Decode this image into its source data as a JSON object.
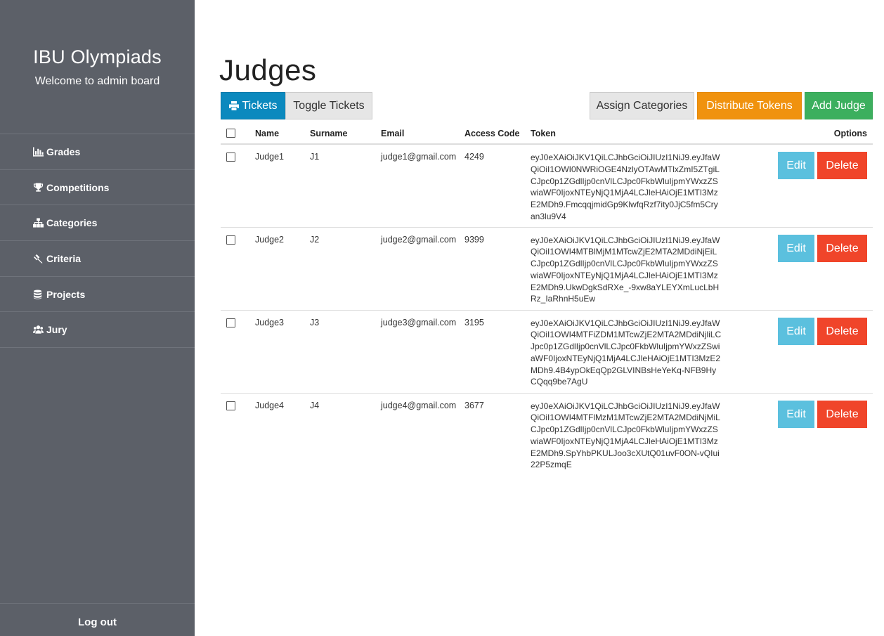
{
  "sidebar": {
    "title": "IBU Olympiads",
    "subtitle": "Welcome to admin board",
    "items": [
      {
        "label": "Grades",
        "icon": "bar-chart-icon"
      },
      {
        "label": "Competitions",
        "icon": "trophy-icon"
      },
      {
        "label": "Categories",
        "icon": "sitemap-icon"
      },
      {
        "label": "Criteria",
        "icon": "gavel-icon"
      },
      {
        "label": "Projects",
        "icon": "database-icon"
      },
      {
        "label": "Jury",
        "icon": "users-icon"
      }
    ],
    "logout": "Log out"
  },
  "main": {
    "title": "Judges",
    "buttons": {
      "tickets": "Tickets",
      "toggle": "Toggle Tickets",
      "assign": "Assign Categories",
      "distribute": "Distribute Tokens",
      "add": "Add Judge"
    }
  },
  "table": {
    "headers": {
      "name": "Name",
      "surname": "Surname",
      "email": "Email",
      "code": "Access Code",
      "token": "Token",
      "options": "Options"
    },
    "rows": [
      {
        "name": "Judge1",
        "surname": "J1",
        "email": "judge1@gmail.com",
        "code": "4249",
        "token": "eyJ0eXAiOiJKV1QiLCJhbGciOiJIUzI1NiJ9.eyJfaWQiOiI1OWI0NWRiOGE4NzlyOTAwMTlxZmI5ZTgiLCJpc0p1ZGdlIjp0cnVlLCJpc0FkbWluIjpmYWxzZSwiaWF0IjoxNTEyNjQ1MjA4LCJleHAiOjE1MTI3MzE2MDh9.FmcqqjmidGp9KlwfqRzf7ity0JjC5fm5Cryan3lu9V4"
      },
      {
        "name": "Judge2",
        "surname": "J2",
        "email": "judge2@gmail.com",
        "code": "9399",
        "token": "eyJ0eXAiOiJKV1QiLCJhbGciOiJIUzI1NiJ9.eyJfaWQiOiI1OWI4MTBlMjM1MTcwZjE2MTA2MDdiNjEiLCJpc0p1ZGdlIjp0cnVlLCJpc0FkbWluIjpmYWxzZSwiaWF0IjoxNTEyNjQ1MjA4LCJleHAiOjE1MTI3MzE2MDh9.UkwDgkSdRXe_-9xw8aYLEYXmLucLbHRz_IaRhnH5uEw"
      },
      {
        "name": "Judge3",
        "surname": "J3",
        "email": "judge3@gmail.com",
        "code": "3195",
        "token": "eyJ0eXAiOiJKV1QiLCJhbGciOiJIUzI1NiJ9.eyJfaWQiOiI1OWI4MTFiZDM1MTcwZjE2MTA2MDdiNjliLCJpc0p1ZGdlIjp0cnVlLCJpc0FkbWluIjpmYWxzZSwiaWF0IjoxNTEyNjQ1MjA4LCJleHAiOjE1MTI3MzE2MDh9.4B4ypOkEqQp2GLVINBsHeYeKq-NFB9HyCQqq9be7AgU"
      },
      {
        "name": "Judge4",
        "surname": "J4",
        "email": "judge4@gmail.com",
        "code": "3677",
        "token": "eyJ0eXAiOiJKV1QiLCJhbGciOiJIUzI1NiJ9.eyJfaWQiOiI1OWI4MTFlMzM1MTcwZjE2MTA2MDdiNjMiLCJpc0p1ZGdlIjp0cnVlLCJpc0FkbWluIjpmYWxzZSwiaWF0IjoxNTEyNjQ1MjA4LCJleHAiOjE1MTI3MzE2MDh9.SpYhbPKULJoo3cXUtQ01uvF0ON-vQIui22P5zmqE"
      }
    ],
    "edit_label": "Edit",
    "delete_label": "Delete"
  },
  "colors": {
    "sidebar_bg": "#5c6068",
    "primary": "#0b89be",
    "warning": "#f0920e",
    "success": "#3caf5e",
    "info": "#5bc0de",
    "danger": "#f0452a"
  }
}
